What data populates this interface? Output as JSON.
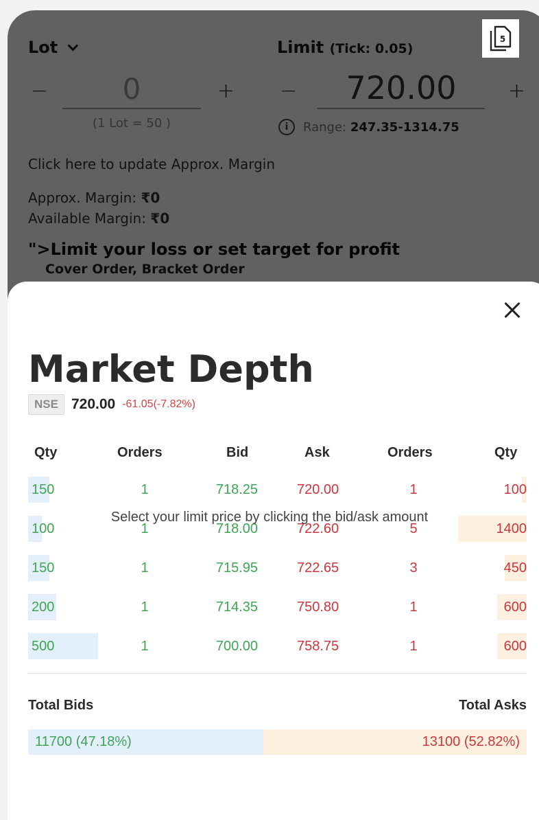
{
  "order_form": {
    "lot_label": "Lot",
    "limit_label": "Limit",
    "tick_label": "(Tick: 0.05)",
    "minus": "−",
    "plus": "+",
    "quantity_value": "0",
    "lot_note": "(1 Lot = 50 )",
    "price_value": "720.00",
    "range_label": "Range:",
    "range_value": "247.35-1314.75",
    "info_glyph": "i",
    "update_margin_link": "Click here to update Approx. Margin",
    "approx_margin_label": "Approx. Margin: ",
    "approx_margin_value": "₹0",
    "available_margin_label": "Available Margin: ",
    "available_margin_value": "₹0",
    "promo_title": "\">Limit your loss or set target for profit",
    "promo_subtitle": "Cover Order, Bracket Order",
    "copy_icon_badge": "5"
  },
  "market_depth": {
    "title": "Market Depth",
    "exchange": "NSE",
    "ltp": "720.00",
    "change": "-61.05(-7.82%)",
    "columns": {
      "bid_qty": "Qty",
      "bid_orders": "Orders",
      "bid": "Bid",
      "ask": "Ask",
      "ask_orders": "Orders",
      "ask_qty": "Qty"
    },
    "rows": [
      {
        "bid_qty": "150",
        "bid_orders": "1",
        "bid": "718.25",
        "ask": "720.00",
        "ask_orders": "1",
        "ask_qty": "100",
        "bid_share": 0.3,
        "ask_share": 0.07
      },
      {
        "bid_qty": "100",
        "bid_orders": "1",
        "bid": "718.00",
        "ask": "722.60",
        "ask_orders": "5",
        "ask_qty": "1400",
        "bid_share": 0.2,
        "ask_share": 1.0
      },
      {
        "bid_qty": "150",
        "bid_orders": "1",
        "bid": "715.95",
        "ask": "722.65",
        "ask_orders": "3",
        "ask_qty": "450",
        "bid_share": 0.3,
        "ask_share": 0.32
      },
      {
        "bid_qty": "200",
        "bid_orders": "1",
        "bid": "714.35",
        "ask": "750.80",
        "ask_orders": "1",
        "ask_qty": "600",
        "bid_share": 0.4,
        "ask_share": 0.43
      },
      {
        "bid_qty": "500",
        "bid_orders": "1",
        "bid": "700.00",
        "ask": "758.75",
        "ask_orders": "1",
        "ask_qty": "600",
        "bid_share": 1.0,
        "ask_share": 0.43
      }
    ],
    "total_bids_label": "Total Bids",
    "total_asks_label": "Total Asks",
    "total_bids": "11700 (47.18%)",
    "total_asks": "13100 (52.82%)",
    "total_bid_fraction": 0.4718,
    "hint": "Select your limit price by clicking the bid/ask amount"
  },
  "colors": {
    "bid": "#3fa555",
    "ask": "#c8383e",
    "bid_bar": "#e3f0fc",
    "ask_bar": "#fdf0df"
  }
}
